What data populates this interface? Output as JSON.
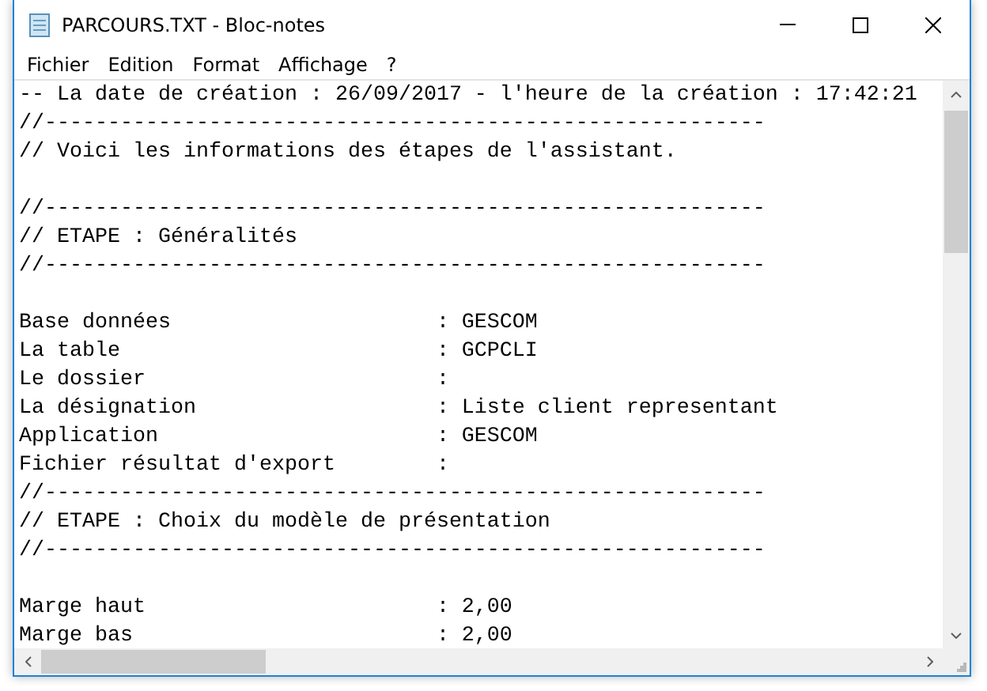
{
  "window": {
    "title": "PARCOURS.TXT - Bloc-notes"
  },
  "menu": [
    "Fichier",
    "Edition",
    "Format",
    "Affichage",
    "?"
  ],
  "lines": [
    {
      "kind": "text",
      "text": "-- La date de création : 26/09/2017 - l'heure de la création : 17:42:21"
    },
    {
      "kind": "text",
      "text": "//---------------------------------------------------------"
    },
    {
      "kind": "text",
      "text": "// Voici les informations des étapes de l'assistant."
    },
    {
      "kind": "blank"
    },
    {
      "kind": "text",
      "text": "//---------------------------------------------------------"
    },
    {
      "kind": "text",
      "text": "// ETAPE : Généralités"
    },
    {
      "kind": "text",
      "text": "//---------------------------------------------------------"
    },
    {
      "kind": "blank"
    },
    {
      "kind": "text",
      "text": "Base données                     : GESCOM"
    },
    {
      "kind": "text",
      "text": "La table                         : GCPCLI"
    },
    {
      "kind": "text",
      "text": "Le dossier                       :"
    },
    {
      "kind": "text",
      "text": "La désignation                   : Liste client representant"
    },
    {
      "kind": "text",
      "text": "Application                      : GESCOM"
    },
    {
      "kind": "text",
      "text": "Fichier résultat d'export        :"
    },
    {
      "kind": "text",
      "text": "//---------------------------------------------------------"
    },
    {
      "kind": "text",
      "text": "// ETAPE : Choix du modèle de présentation"
    },
    {
      "kind": "text",
      "text": "//---------------------------------------------------------"
    },
    {
      "kind": "blank"
    },
    {
      "kind": "text",
      "text": "Marge haut                       : 2,00"
    },
    {
      "kind": "text",
      "text": "Marge bas                        : 2,00"
    }
  ]
}
